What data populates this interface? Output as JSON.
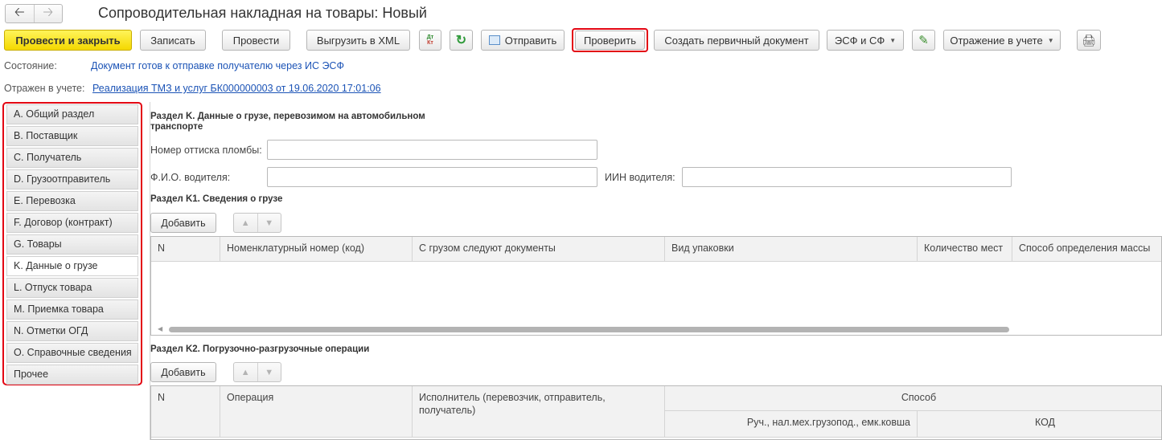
{
  "window": {
    "title": "Сопроводительная накладная на товары: Новый"
  },
  "nav": {
    "back_icon": "arrow-left-icon",
    "forward_icon": "arrow-right-icon"
  },
  "toolbar": {
    "post_close": "Провести и закрыть",
    "save": "Записать",
    "post": "Провести",
    "export_xml": "Выгрузить в XML",
    "dtkt_icon": "Дт/Кт",
    "send": "Отправить",
    "check": "Проверить",
    "create_primary": "Создать первичный документ",
    "esf_sf": "ЭСФ и СФ",
    "reflect": "Отражение в учете"
  },
  "status": {
    "state_label": "Состояние:",
    "state_value": "Документ готов к отправке получателю через ИС ЭСФ",
    "reflected_label": "Отражен в учете:",
    "reflected_value": "Реализация ТМЗ и услуг БК000000003 от 19.06.2020 17:01:06"
  },
  "sidebar": {
    "items": [
      {
        "label": "A. Общий раздел"
      },
      {
        "label": "B. Поставщик"
      },
      {
        "label": "C. Получатель"
      },
      {
        "label": "D. Грузоотправитель"
      },
      {
        "label": "E. Перевозка"
      },
      {
        "label": "F. Договор (контракт)"
      },
      {
        "label": "G. Товары"
      },
      {
        "label": "K. Данные о грузе"
      },
      {
        "label": "L. Отпуск товара"
      },
      {
        "label": "M. Приемка товара"
      },
      {
        "label": "N. Отметки ОГД"
      },
      {
        "label": "O. Справочные сведения"
      },
      {
        "label": "Прочее"
      }
    ],
    "active_index": 7
  },
  "section_k": {
    "title_line1": "Раздел K. Данные о грузе, перевозимом на автомобильном",
    "title_line2": "транспорте",
    "seal_label": "Номер оттиска пломбы:",
    "seal_value": "",
    "driver_label": "Ф.И.О. водителя:",
    "driver_value": "",
    "iin_label": "ИИН водителя:",
    "iin_value": ""
  },
  "section_k1": {
    "title": "Раздел K1. Сведения о грузе",
    "add_button": "Добавить",
    "columns": [
      "N",
      "Номенклатурный номер (код)",
      "С грузом следуют документы",
      "Вид упаковки",
      "Количество мест",
      "Способ определения массы"
    ]
  },
  "section_k2": {
    "title": "Раздел K2. Погрузочно-разгрузочные операции",
    "add_button": "Добавить",
    "columns": {
      "n": "N",
      "operation": "Операция",
      "executor": "Исполнитель (перевозчик, отправитель, получатель)",
      "method": "Способ",
      "method_sub1": "Руч., нал.мех.грузопод., емк.ковша",
      "method_sub2": "КОД"
    }
  }
}
